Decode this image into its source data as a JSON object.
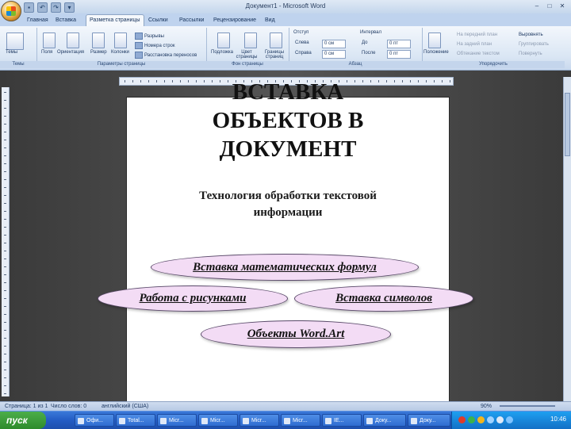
{
  "window": {
    "title": "Документ1 - Microsoft Word",
    "controls": [
      "–",
      "□",
      "✕"
    ]
  },
  "quick_access": [
    "save-icon",
    "undo-icon",
    "redo-icon",
    "dropdown-icon"
  ],
  "tabs": [
    "Главная",
    "Вставка",
    "Разметка страницы",
    "Ссылки",
    "Рассылки",
    "Рецензирование",
    "Вид"
  ],
  "active_tab": "Разметка страницы",
  "ribbon": {
    "groups": [
      {
        "label": "Темы",
        "items": [
          "Темы"
        ]
      },
      {
        "label": "Параметры страницы",
        "items": [
          "Поля",
          "Ориентация",
          "Размер",
          "Колонки",
          "Разрывы",
          "Номера строк",
          "Расстановка переносов"
        ]
      },
      {
        "label": "Фон страницы",
        "items": [
          "Подложка",
          "Цвет страницы",
          "Границы страниц"
        ]
      },
      {
        "label": "Абзац",
        "items": [
          "Отступ",
          "Слева",
          "Справа",
          "Интервал",
          "До",
          "После"
        ],
        "values": [
          "0 см",
          "0 см",
          "0 пт",
          "0 пт"
        ]
      },
      {
        "label": "Упорядочить",
        "items": [
          "Положение",
          "На передний план",
          "На задний план",
          "Обтекание текстом",
          "Выровнять",
          "Группировать",
          "Повернуть"
        ]
      }
    ]
  },
  "document": {
    "title_lines": [
      "ВСТАВКА",
      "ОБЪЕКТОВ В",
      "ДОКУМЕНТ"
    ],
    "subtitle_lines": [
      "Технология обработки текстовой",
      "информации"
    ],
    "topics": [
      "Вставка математических формул",
      "Работа с рисунками",
      "Вставка символов",
      "Объекты Word.Art"
    ]
  },
  "statusbar": {
    "page": "Страница: 1 из 1",
    "words": "Число слов: 0",
    "language": "английский (США)",
    "zoom": "90%"
  },
  "taskbar": {
    "start": "пуск",
    "buttons": [
      "Офи...",
      "Total...",
      "Micr...",
      "Micr...",
      "Micr...",
      "Micr...",
      "IE...",
      "Доку...",
      "Доку..."
    ],
    "clock": "10:46"
  },
  "colors": {
    "oval_fill": "#f3dcf5",
    "ribbon_bg": "#dae6f4",
    "taskbar": "#245cc4"
  }
}
